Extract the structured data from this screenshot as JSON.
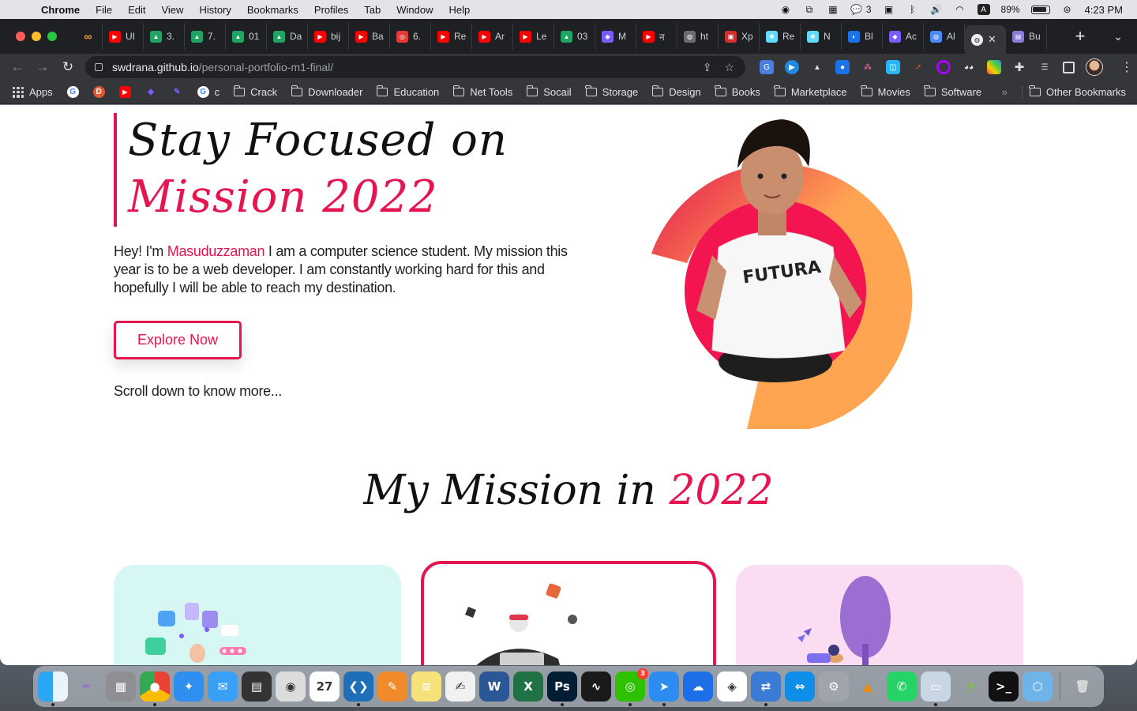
{
  "menubar": {
    "app_name": "Chrome",
    "menus": [
      "File",
      "Edit",
      "View",
      "History",
      "Bookmarks",
      "Profiles",
      "Tab",
      "Window",
      "Help"
    ],
    "wechat_count": "3",
    "input_source": "A",
    "battery": "89%",
    "clock": "4:23 PM"
  },
  "tabs": [
    {
      "label": "UI",
      "color": "#ff0000",
      "glyph": "▶"
    },
    {
      "label": "3.",
      "color": "#1fa463",
      "glyph": "▲"
    },
    {
      "label": "7.",
      "color": "#1fa463",
      "glyph": "▲"
    },
    {
      "label": "01",
      "color": "#1fa463",
      "glyph": "▲"
    },
    {
      "label": "Da",
      "color": "#1fa463",
      "glyph": "▲"
    },
    {
      "label": "bij",
      "color": "#ff0000",
      "glyph": "▶"
    },
    {
      "label": "Ba",
      "color": "#ff0000",
      "glyph": "▶"
    },
    {
      "label": "6.",
      "color": "#e53935",
      "glyph": "◎"
    },
    {
      "label": "Re",
      "color": "#ff0000",
      "glyph": "▶"
    },
    {
      "label": "Ar",
      "color": "#ff0000",
      "glyph": "▶"
    },
    {
      "label": "Le",
      "color": "#ff0000",
      "glyph": "▶"
    },
    {
      "label": "03",
      "color": "#1fa463",
      "glyph": "▲"
    },
    {
      "label": "M",
      "color": "#7b5cff",
      "glyph": "◆"
    },
    {
      "label": "न",
      "color": "#ff0000",
      "glyph": "▶"
    },
    {
      "label": "ht",
      "color": "#6d6d6d",
      "glyph": "◍"
    },
    {
      "label": "Xp",
      "color": "#d32f2f",
      "glyph": "▣"
    },
    {
      "label": "Re",
      "color": "#61dafb",
      "glyph": "✺"
    },
    {
      "label": "N",
      "color": "#61dafb",
      "glyph": "✺"
    },
    {
      "label": "Bl",
      "color": "#1a73e8",
      "glyph": "◐"
    },
    {
      "label": "Ac",
      "color": "#7b5cff",
      "glyph": "◆"
    },
    {
      "label": "Al",
      "color": "#4c8bf5",
      "glyph": "◍"
    }
  ],
  "active_tab": {
    "label": "",
    "close": "✕"
  },
  "last_tab": {
    "label": "Bu"
  },
  "address": {
    "host": "swdrana.github.io",
    "path": "/personal-portfolio-m1-final/"
  },
  "bookmarks": {
    "apps_label": "Apps",
    "short_label": "c",
    "folders": [
      "Crack",
      "Downloader",
      "Education",
      "Net Tools",
      "Socail",
      "Storage",
      "Design",
      "Books",
      "Marketplace",
      "Movies",
      "Software"
    ],
    "more": "»",
    "other": "Other Bookmarks"
  },
  "page": {
    "hero_line1": "Stay Focused on",
    "hero_line2": "Mission 2022",
    "intro_before": "Hey! I'm ",
    "intro_name": "Masuduzzaman",
    "intro_after": " I am a computer science student. My mission this year is to be a web developer. I am constantly working hard for this and hopefully I will be able to reach my destination.",
    "cta_label": "Explore Now",
    "scroll_hint": "Scroll down to know more...",
    "mission_heading": "My Mission in ",
    "mission_year": "2022",
    "shirt_text": "FUTURA"
  },
  "colors": {
    "accent": "#e5164f",
    "ring_orange": "#ffa552",
    "card1_bg": "#d6f7f3",
    "card3_bg": "#fadcf3"
  },
  "dock": [
    {
      "name": "finder",
      "bg": "linear-gradient(90deg,#2aa6f5 50%,#e8f3fb 50%)",
      "glyph": ""
    },
    {
      "name": "feather",
      "bg": "transparent",
      "glyph": "✒"
    },
    {
      "name": "calculator",
      "bg": "#8e8e93",
      "glyph": "▦"
    },
    {
      "name": "chrome",
      "bg": "conic-gradient(#ea4335 0 33%,#fbbc05 0 66%,#34a853 0)",
      "glyph": "●"
    },
    {
      "name": "safari",
      "bg": "#2f8ff0",
      "glyph": "✦"
    },
    {
      "name": "mail",
      "bg": "#3aa0f5",
      "glyph": "✉"
    },
    {
      "name": "multi",
      "bg": "#333333",
      "glyph": "▤"
    },
    {
      "name": "screenshot",
      "bg": "#dcdcdc",
      "glyph": "◉"
    },
    {
      "name": "calendar",
      "bg": "#ffffff",
      "glyph": "27"
    },
    {
      "name": "vscode",
      "bg": "#1e6fb8",
      "glyph": "❮❯"
    },
    {
      "name": "pen",
      "bg": "#f08a2a",
      "glyph": "✎"
    },
    {
      "name": "notes",
      "bg": "#f6e27a",
      "glyph": "≡"
    },
    {
      "name": "textedit",
      "bg": "#f1f1f1",
      "glyph": "✍"
    },
    {
      "name": "word",
      "bg": "#2b5797",
      "glyph": "W"
    },
    {
      "name": "excel",
      "bg": "#1f7244",
      "glyph": "X"
    },
    {
      "name": "photoshop",
      "bg": "#001d34",
      "glyph": "Ps"
    },
    {
      "name": "activity",
      "bg": "#1a1a1a",
      "glyph": "∿"
    },
    {
      "name": "wechat",
      "bg": "#2dc100",
      "glyph": "◎",
      "badge": "3"
    },
    {
      "name": "send",
      "bg": "#2d8cf0",
      "glyph": "➤"
    },
    {
      "name": "cloud",
      "bg": "#1c6fe6",
      "glyph": "☁"
    },
    {
      "name": "cube",
      "bg": "#ffffff",
      "glyph": "◈"
    },
    {
      "name": "transfer",
      "bg": "#3a7bd5",
      "glyph": "⇄"
    },
    {
      "name": "teamviewer",
      "bg": "#0e8ee9",
      "glyph": "⇔"
    },
    {
      "name": "settings",
      "bg": "#a0a5ad",
      "glyph": "⚙"
    },
    {
      "name": "vlc",
      "bg": "transparent",
      "glyph": "▲"
    },
    {
      "name": "whatsapp",
      "bg": "#25d366",
      "glyph": "✆"
    },
    {
      "name": "preview",
      "bg": "#c9d6e3",
      "glyph": "▭"
    },
    {
      "name": "chameleon",
      "bg": "transparent",
      "glyph": "◔"
    },
    {
      "name": "terminal",
      "bg": "#111111",
      "glyph": ">_"
    },
    {
      "name": "box",
      "bg": "#6fb4e8",
      "glyph": "⬡"
    },
    {
      "name": "trash",
      "bg": "transparent",
      "glyph": "🗑"
    }
  ]
}
